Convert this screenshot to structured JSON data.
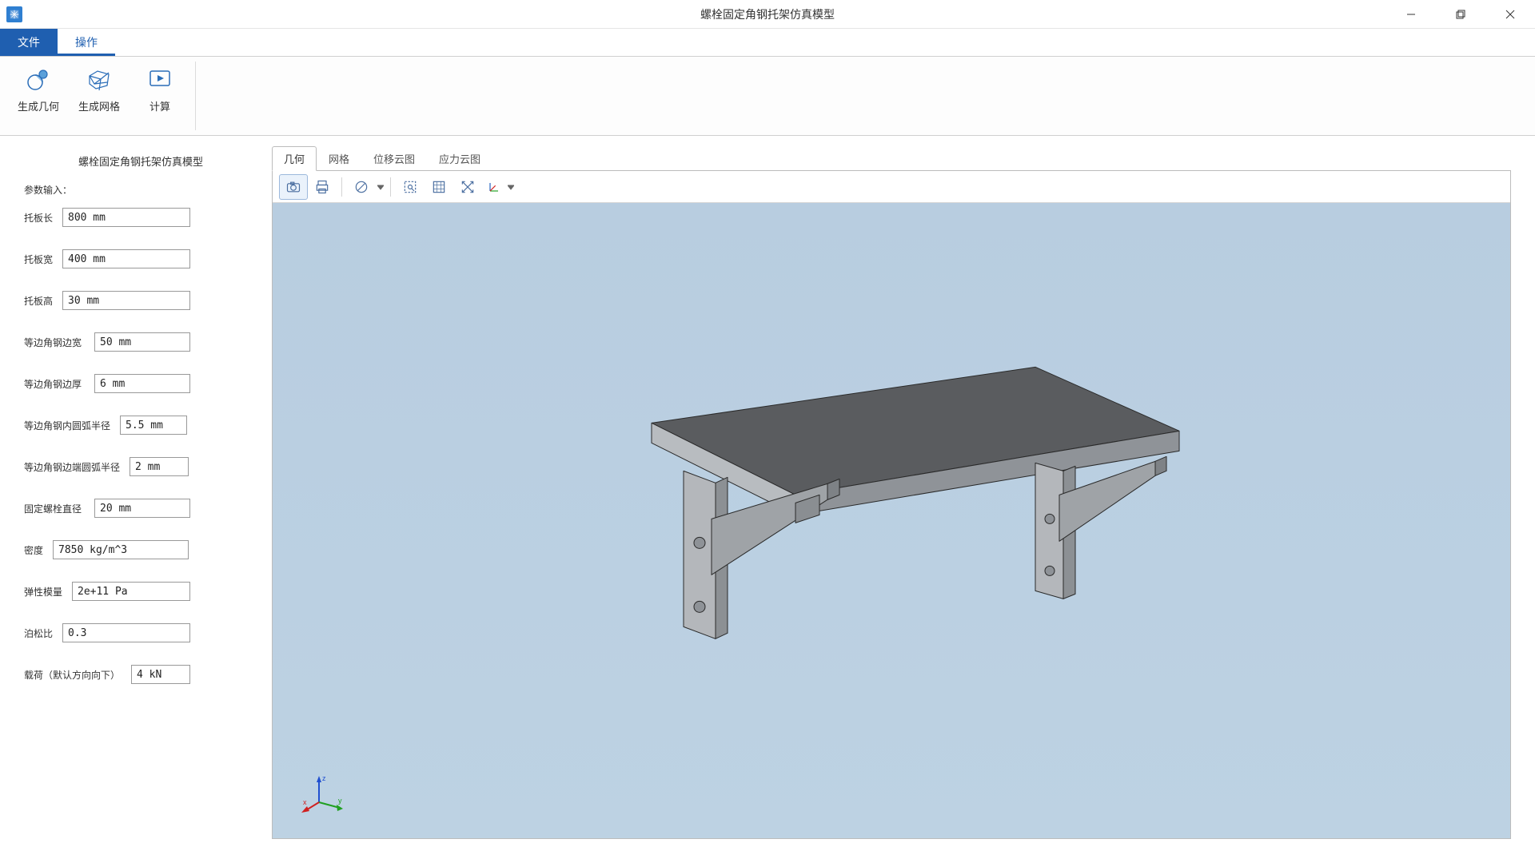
{
  "window": {
    "title": "螺栓固定角钢托架仿真模型"
  },
  "menu": {
    "file": "文件",
    "operate": "操作"
  },
  "ribbon": {
    "gen_geometry": "生成几何",
    "gen_mesh": "生成网格",
    "compute": "计算"
  },
  "sidebar": {
    "title": "螺栓固定角钢托架仿真模型",
    "input_header": "参数输入：",
    "params": {
      "plate_len": {
        "label": "托板长",
        "value": "800 mm"
      },
      "plate_wid": {
        "label": "托板宽",
        "value": "400 mm"
      },
      "plate_hgt": {
        "label": "托板高",
        "value": "30 mm"
      },
      "angle_width": {
        "label": "等边角钢边宽",
        "value": "50 mm"
      },
      "angle_thick": {
        "label": "等边角钢边厚",
        "value": "6 mm"
      },
      "angle_in_r": {
        "label": "等边角钢内圆弧半径",
        "value": "5.5 mm"
      },
      "angle_edge_r": {
        "label": "等边角钢边端圆弧半径",
        "value": "2 mm"
      },
      "bolt_dia": {
        "label": "固定螺栓直径",
        "value": "20 mm"
      },
      "density": {
        "label": "密度",
        "value": "7850 kg/m^3"
      },
      "young": {
        "label": "弹性模量",
        "value": "2e+11 Pa"
      },
      "poisson": {
        "label": "泊松比",
        "value": "0.3"
      },
      "load": {
        "label": "载荷（默认方向向下）",
        "value": "4 kN"
      }
    }
  },
  "viewer": {
    "tabs": {
      "geometry": "几何",
      "mesh": "网格",
      "disp": "位移云图",
      "stress": "应力云图"
    },
    "triad": {
      "x": "x",
      "y": "y",
      "z": "z"
    }
  }
}
